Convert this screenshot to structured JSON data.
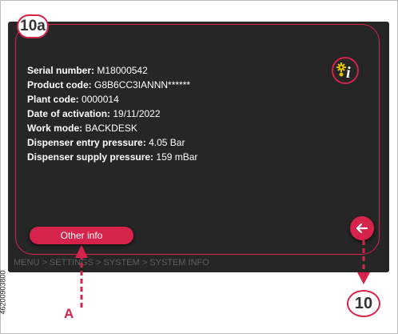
{
  "callout_top": "10a",
  "callout_bottom": "10",
  "label_a": "A",
  "side_code": "46200903800",
  "info": [
    {
      "label": "Serial number:",
      "value": "M18000542"
    },
    {
      "label": "Product code:",
      "value": "G8B6CC3IANNN******"
    },
    {
      "label": "Plant code:",
      "value": "0000014"
    },
    {
      "label": "Date of activation:",
      "value": "19/11/2022"
    },
    {
      "label": "Work mode:",
      "value": "BACKDESK"
    },
    {
      "label": "Dispenser entry pressure:",
      "value": "4.05 Bar"
    },
    {
      "label": "Dispenser supply pressure:",
      "value": "159 mBar"
    }
  ],
  "buttons": {
    "other_info": "Other info"
  },
  "breadcrumb": "MENU > SETTINGS > SYSTEM > SYSTEM INFO",
  "colors": {
    "accent": "#d6234c",
    "screen_bg": "#262626",
    "text": "#ffffff",
    "breadcrumb_text": "#5e5e5e"
  },
  "icons": {
    "system_info": "gears-info-icon",
    "back": "arrow-left-icon"
  }
}
